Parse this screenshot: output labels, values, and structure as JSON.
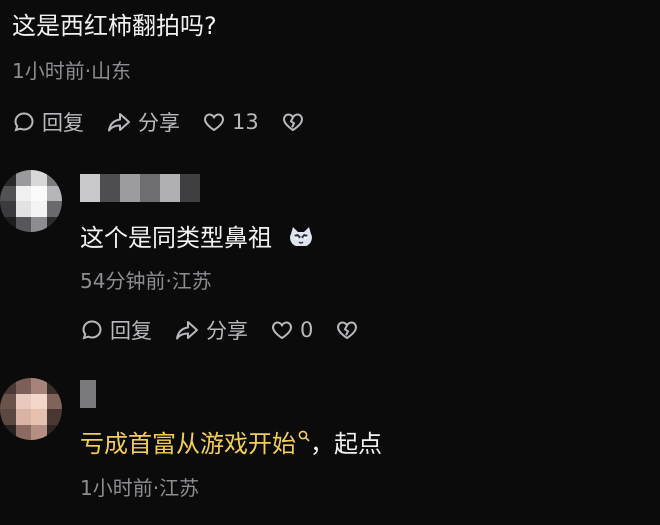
{
  "comments": [
    {
      "text": "这是西红柿翻拍吗?",
      "meta": "1小时前·山东",
      "reply_label": "回复",
      "share_label": "分享",
      "likes": "13"
    },
    {
      "text": "这个是同类型鼻祖",
      "emoji": "cat-emoji",
      "meta": "54分钟前·江苏",
      "reply_label": "回复",
      "share_label": "分享",
      "likes": "0"
    },
    {
      "link_text": "亏成首富从游戏开始",
      "suffix": "，起点",
      "meta": "1小时前·江苏"
    }
  ],
  "colors": {
    "background": "#0b0b0c",
    "text": "#f1f1f2",
    "meta": "#8d8d92",
    "link": "#f2cd58"
  }
}
